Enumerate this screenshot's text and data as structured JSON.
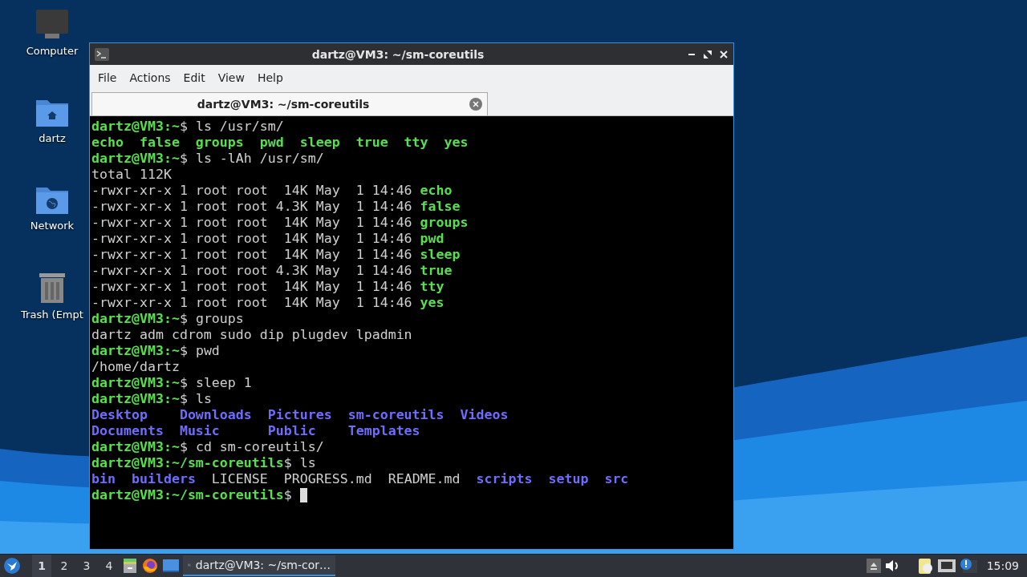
{
  "desktop_icons": [
    {
      "label": "Computer",
      "kind": "computer"
    },
    {
      "label": "dartz",
      "kind": "home"
    },
    {
      "label": "Network",
      "kind": "network"
    },
    {
      "label": "Trash (Empt",
      "kind": "trash"
    }
  ],
  "window": {
    "title": "dartz@VM3: ~/sm-coreutils",
    "menu": [
      "File",
      "Actions",
      "Edit",
      "View",
      "Help"
    ],
    "tabs": [
      {
        "label": "dartz@VM3: ~/sm-coreutils",
        "selected": true
      }
    ],
    "terminal": [
      {
        "segments": [
          {
            "kind": "prompt",
            "text": "dartz@VM3:~"
          },
          {
            "kind": "plain",
            "text": "$ ls /usr/sm/"
          }
        ]
      },
      {
        "segments": [
          {
            "kind": "exec",
            "text": "echo  false  groups  pwd  sleep  true  tty  yes"
          }
        ]
      },
      {
        "segments": [
          {
            "kind": "prompt",
            "text": "dartz@VM3:~"
          },
          {
            "kind": "plain",
            "text": "$ ls -lAh /usr/sm/"
          }
        ]
      },
      {
        "segments": [
          {
            "kind": "plain",
            "text": "total 112K"
          }
        ]
      },
      {
        "segments": [
          {
            "kind": "plain",
            "text": "-rwxr-xr-x 1 root root  14K May  1 14:46 "
          },
          {
            "kind": "exec",
            "text": "echo"
          }
        ]
      },
      {
        "segments": [
          {
            "kind": "plain",
            "text": "-rwxr-xr-x 1 root root 4.3K May  1 14:46 "
          },
          {
            "kind": "exec",
            "text": "false"
          }
        ]
      },
      {
        "segments": [
          {
            "kind": "plain",
            "text": "-rwxr-xr-x 1 root root  14K May  1 14:46 "
          },
          {
            "kind": "exec",
            "text": "groups"
          }
        ]
      },
      {
        "segments": [
          {
            "kind": "plain",
            "text": "-rwxr-xr-x 1 root root  14K May  1 14:46 "
          },
          {
            "kind": "exec",
            "text": "pwd"
          }
        ]
      },
      {
        "segments": [
          {
            "kind": "plain",
            "text": "-rwxr-xr-x 1 root root  14K May  1 14:46 "
          },
          {
            "kind": "exec",
            "text": "sleep"
          }
        ]
      },
      {
        "segments": [
          {
            "kind": "plain",
            "text": "-rwxr-xr-x 1 root root 4.3K May  1 14:46 "
          },
          {
            "kind": "exec",
            "text": "true"
          }
        ]
      },
      {
        "segments": [
          {
            "kind": "plain",
            "text": "-rwxr-xr-x 1 root root  14K May  1 14:46 "
          },
          {
            "kind": "exec",
            "text": "tty"
          }
        ]
      },
      {
        "segments": [
          {
            "kind": "plain",
            "text": "-rwxr-xr-x 1 root root  14K May  1 14:46 "
          },
          {
            "kind": "exec",
            "text": "yes"
          }
        ]
      },
      {
        "segments": [
          {
            "kind": "prompt",
            "text": "dartz@VM3:~"
          },
          {
            "kind": "plain",
            "text": "$ groups"
          }
        ]
      },
      {
        "segments": [
          {
            "kind": "plain",
            "text": "dartz adm cdrom sudo dip plugdev lpadmin"
          }
        ]
      },
      {
        "segments": [
          {
            "kind": "prompt",
            "text": "dartz@VM3:~"
          },
          {
            "kind": "plain",
            "text": "$ pwd"
          }
        ]
      },
      {
        "segments": [
          {
            "kind": "plain",
            "text": "/home/dartz"
          }
        ]
      },
      {
        "segments": [
          {
            "kind": "prompt",
            "text": "dartz@VM3:~"
          },
          {
            "kind": "plain",
            "text": "$ sleep 1"
          }
        ]
      },
      {
        "segments": [
          {
            "kind": "prompt",
            "text": "dartz@VM3:~"
          },
          {
            "kind": "plain",
            "text": "$ ls"
          }
        ]
      },
      {
        "segments": [
          {
            "kind": "dir",
            "text": "Desktop    Downloads  Pictures  sm-coreutils  Videos"
          }
        ]
      },
      {
        "segments": [
          {
            "kind": "dir",
            "text": "Documents  Music      Public    Templates"
          }
        ]
      },
      {
        "segments": [
          {
            "kind": "prompt",
            "text": "dartz@VM3:~"
          },
          {
            "kind": "plain",
            "text": "$ cd sm-coreutils/"
          }
        ]
      },
      {
        "segments": [
          {
            "kind": "prompt",
            "text": "dartz@VM3:~/sm-coreutils"
          },
          {
            "kind": "plain",
            "text": "$ ls"
          }
        ]
      },
      {
        "segments": [
          {
            "kind": "dir",
            "text": "bin"
          },
          {
            "kind": "dir",
            "text": "builders"
          },
          {
            "kind": "plain",
            "text": "  LICENSE  PROGRESS.md  README.md  "
          },
          {
            "kind": "dir",
            "text": "scripts"
          },
          {
            "kind": "dir",
            "text": "setup"
          },
          {
            "kind": "dir",
            "text": "src"
          }
        ]
      },
      {
        "segments": [
          {
            "kind": "prompt",
            "text": "dartz@VM3:~/sm-coreutils"
          },
          {
            "kind": "plain",
            "text": "$ "
          }
        ],
        "cursor": true
      }
    ]
  },
  "taskbar": {
    "workspaces": [
      {
        "label": "1",
        "selected": true
      },
      {
        "label": "2",
        "selected": false
      },
      {
        "label": "3",
        "selected": false
      },
      {
        "label": "4",
        "selected": false
      }
    ],
    "tasks": [
      {
        "label": "dartz@VM3: ~/sm-cor…",
        "selected": true
      }
    ],
    "clock": "15:09"
  }
}
